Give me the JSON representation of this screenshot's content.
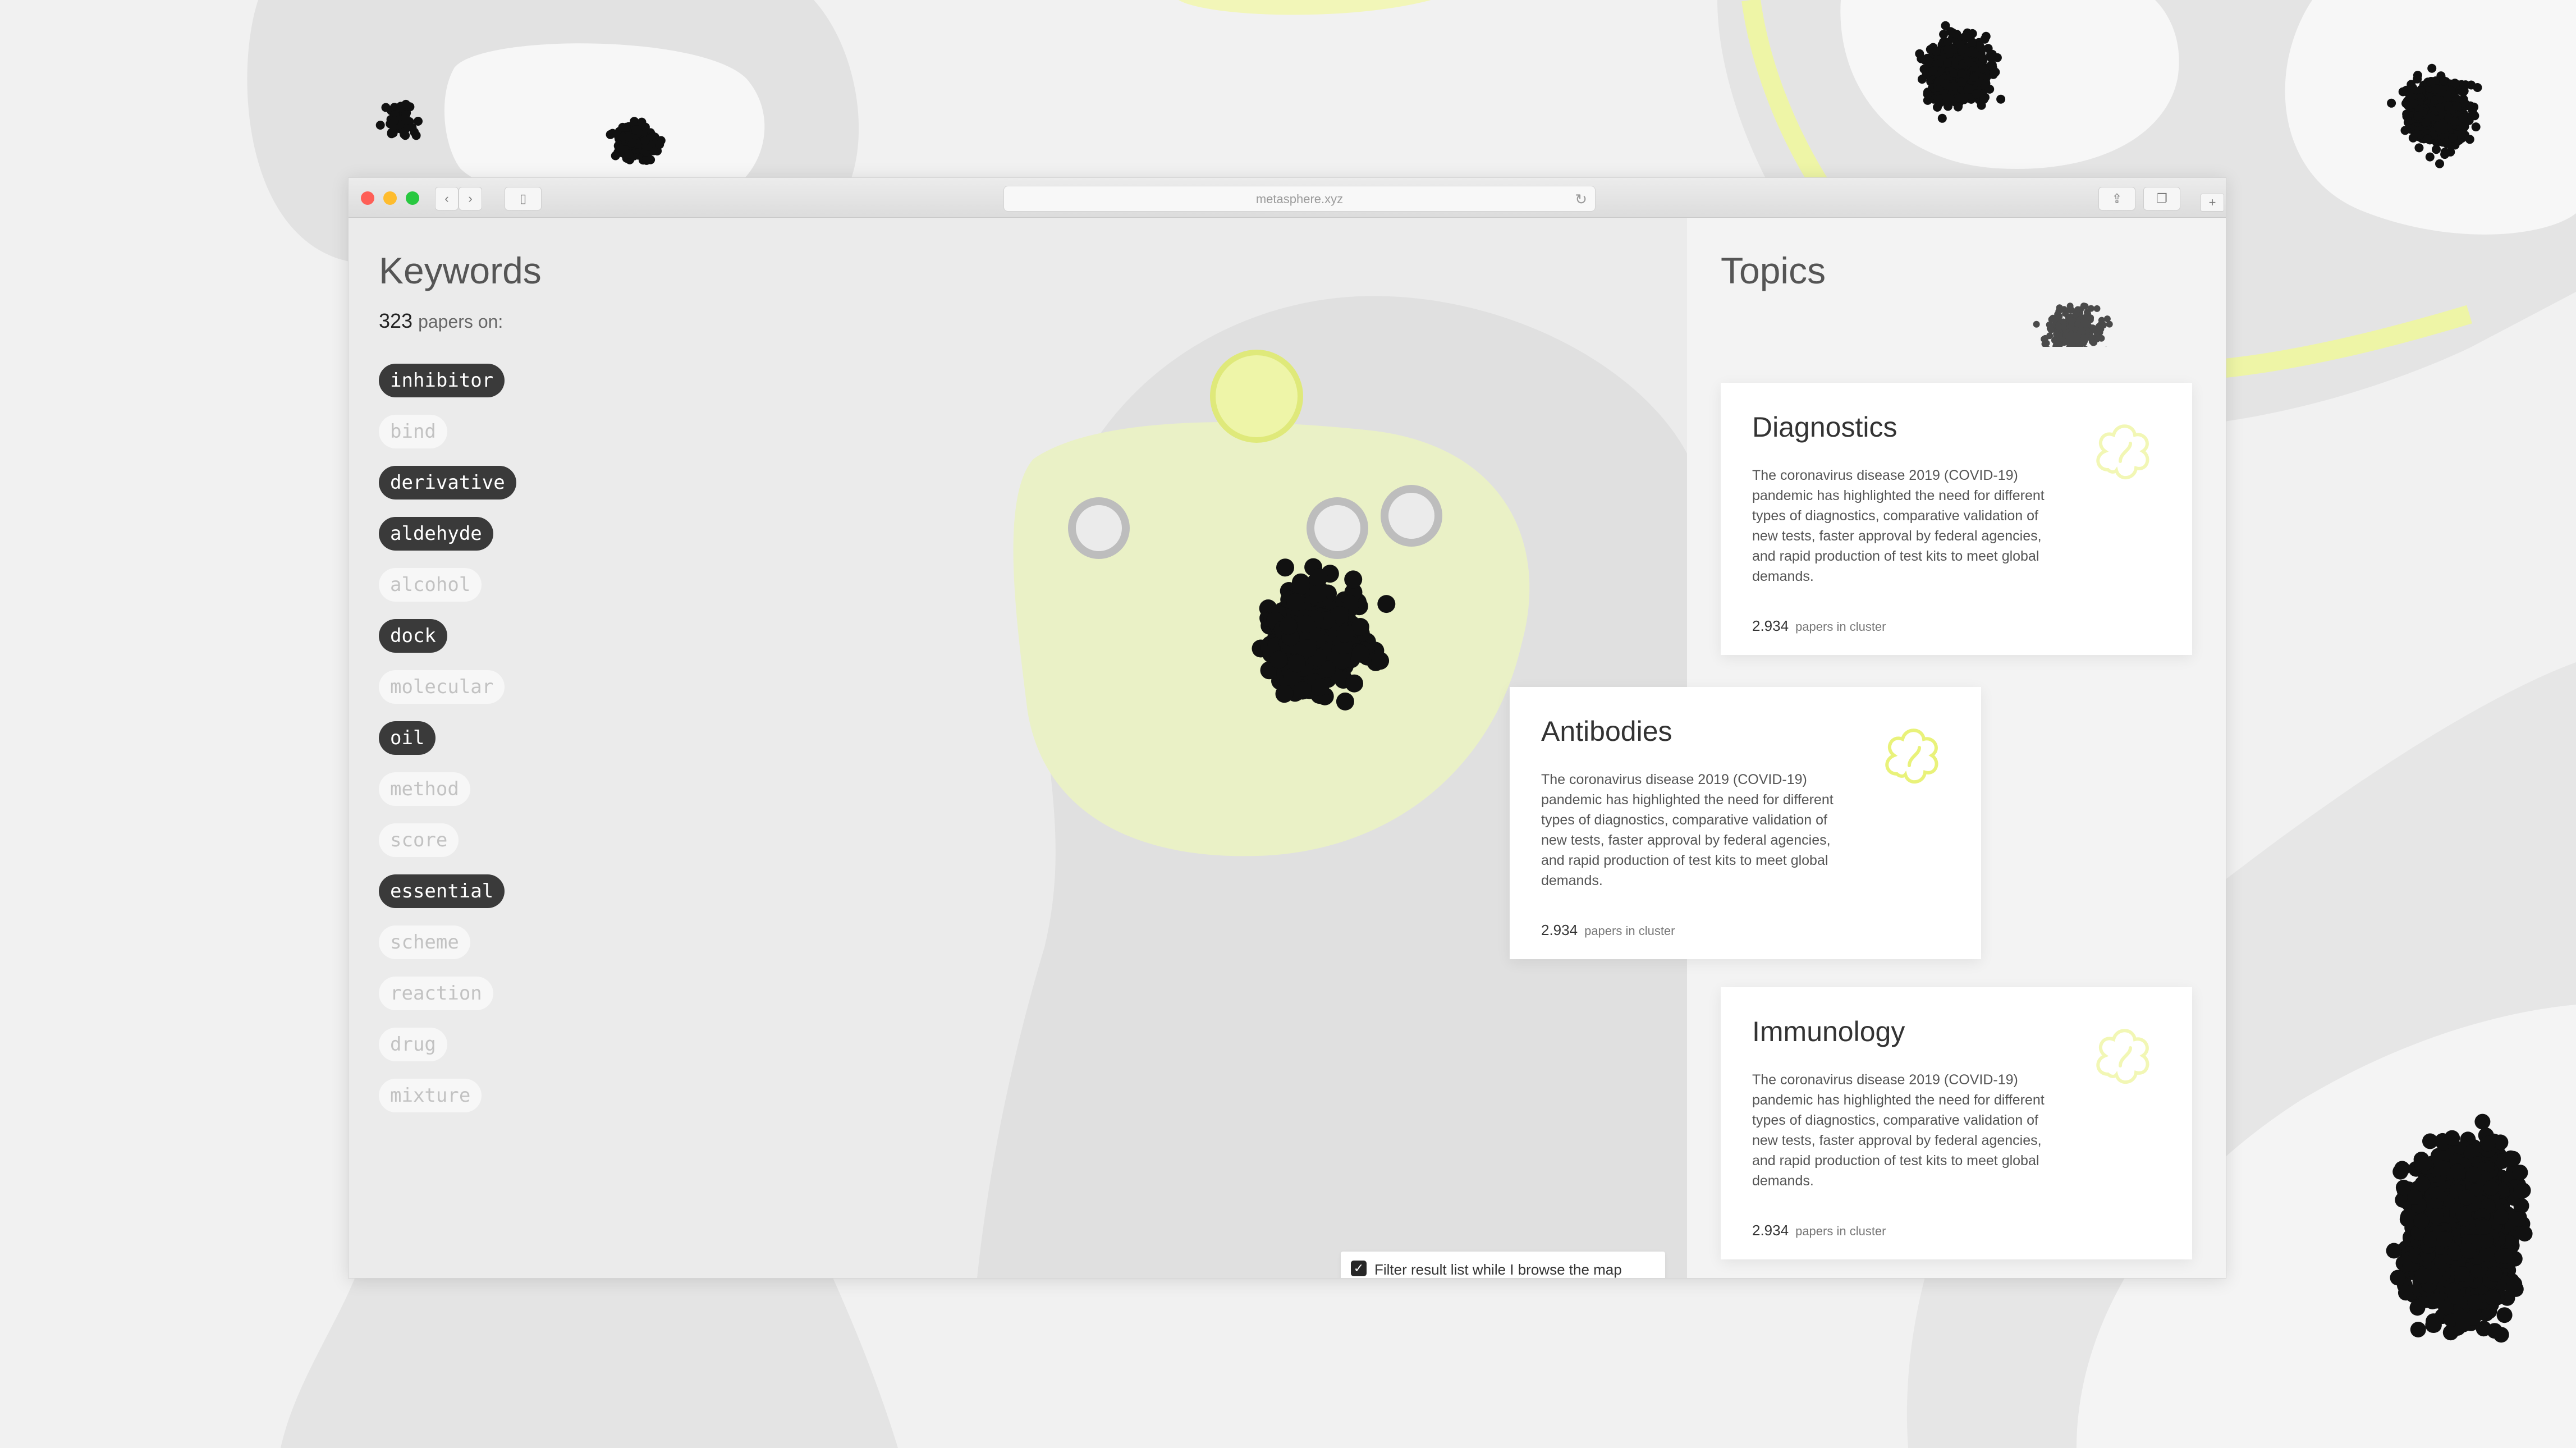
{
  "browser": {
    "url": "metasphere.xyz"
  },
  "keywords": {
    "title": "Keywords",
    "count": "323",
    "count_label": "papers on:",
    "items": [
      {
        "label": "inhibitor",
        "active": true
      },
      {
        "label": "bind",
        "active": false
      },
      {
        "label": "derivative",
        "active": true
      },
      {
        "label": "aldehyde",
        "active": true
      },
      {
        "label": "alcohol",
        "active": false
      },
      {
        "label": "dock",
        "active": true
      },
      {
        "label": "molecular",
        "active": false
      },
      {
        "label": "oil",
        "active": true
      },
      {
        "label": "method",
        "active": false
      },
      {
        "label": "score",
        "active": false
      },
      {
        "label": "essential",
        "active": true
      },
      {
        "label": "scheme",
        "active": false
      },
      {
        "label": "reaction",
        "active": false
      },
      {
        "label": "drug",
        "active": false
      },
      {
        "label": "mixture",
        "active": false
      }
    ]
  },
  "topics": {
    "title": "Topics",
    "cards": [
      {
        "title": "Diagnostics",
        "text": "The coronavirus disease 2019 (COVID-19) pandemic has highlighted the need for different types of diagnostics, comparative validation of new tests, faster approval by federal agencies, and rapid production of test kits to meet global demands.",
        "count": "2.934",
        "count_label": "papers in cluster"
      },
      {
        "title": "Antibodies",
        "text": "The coronavirus disease 2019 (COVID-19) pandemic has highlighted the need for different types of diagnostics, comparative validation of new tests, faster approval by federal agencies, and rapid production of test kits to meet global demands.",
        "count": "2.934",
        "count_label": "papers in cluster"
      },
      {
        "title": "Immunology",
        "text": "The coronavirus disease 2019 (COVID-19) pandemic has highlighted the need for different types of diagnostics, comparative validation of new tests, faster approval by federal agencies, and rapid production of test kits to meet global demands.",
        "count": "2.934",
        "count_label": "papers in cluster"
      }
    ]
  },
  "filter": {
    "label": "Filter result list while I browse the map",
    "checked": true
  },
  "colors": {
    "accent": "#e9f27a",
    "active_tag": "#3a3a3a",
    "dots": "#111111"
  }
}
